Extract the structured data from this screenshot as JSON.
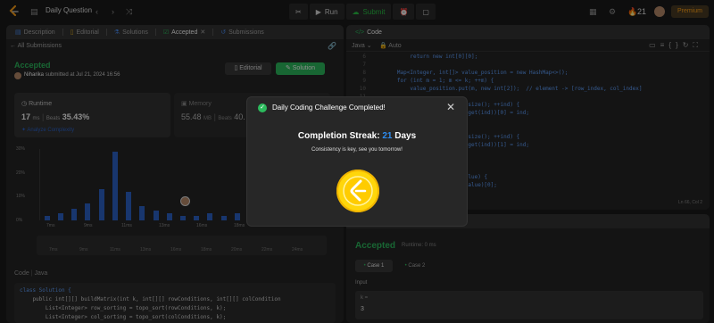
{
  "topbar": {
    "title": "Daily Question",
    "run": "Run",
    "submit": "Submit",
    "streak_count": "21",
    "premium": "Premium"
  },
  "left_panel": {
    "tabs": [
      {
        "label": "Description"
      },
      {
        "label": "Editorial"
      },
      {
        "label": "Solutions"
      },
      {
        "label": "Accepted"
      },
      {
        "label": "Submissions"
      }
    ],
    "back_link": "All Submissions",
    "status": "Accepted",
    "author": "Niharika",
    "submitted": "submitted at Jul 21, 2024 16:56",
    "editorial_btn": "Editorial",
    "solution_btn": "Solution",
    "runtime": {
      "label": "Runtime",
      "value": "17",
      "unit": "ms",
      "beats_label": "Beats",
      "beats_value": "35.43%"
    },
    "memory": {
      "label": "Memory",
      "value": "55.48",
      "unit": "MB",
      "beats_label": "Beats",
      "beats_value": "40."
    },
    "analyze": "Analyze Complexity",
    "code_header": "Code",
    "language": "Java"
  },
  "chart_data": {
    "type": "bar",
    "ylabel_ticks": [
      "30%",
      "20%",
      "10%",
      "0%"
    ],
    "ylim": [
      0,
      30
    ],
    "x_ticks": [
      "7ms",
      "9ms",
      "11ms",
      "13ms",
      "16ms",
      "18ms",
      "20ms"
    ],
    "x_ticks_range": [
      "7ms",
      "9ms",
      "11ms",
      "13ms",
      "16ms",
      "18ms",
      "20ms",
      "22ms",
      "24ms"
    ],
    "values": [
      2,
      3,
      5,
      7,
      13,
      29,
      12,
      6,
      4,
      3,
      2,
      2,
      3,
      2,
      3,
      2,
      2,
      4,
      1,
      3,
      2
    ]
  },
  "code_editor": {
    "title": "Code",
    "language": "Java",
    "mode": "Auto",
    "lines": [
      {
        "n": "6",
        "text": "            return new int[0][0];"
      },
      {
        "n": "7",
        "text": ""
      },
      {
        "n": "8",
        "text": "        Map<Integer, int[]> value_position = new HashMap<>();"
      },
      {
        "n": "9",
        "text": "        for (int m = 1; m <= k; ++m) {"
      },
      {
        "n": "10",
        "text": "            value_position.put(m, new int[2]);  // element -> [row_index, col_index]"
      },
      {
        "n": "11",
        "text": ""
      },
      {
        "n": "12",
        "text": "                < row_sorting.size(); ++ind) {"
      },
      {
        "n": "13",
        "text": "                t(row_sorting.get(ind))[0] = ind;"
      },
      {
        "n": "14",
        "text": ""
      },
      {
        "n": "15",
        "text": ""
      },
      {
        "n": "16",
        "text": "                < col_sorting.size(); ++ind) {"
      },
      {
        "n": "17",
        "text": "                t(col_sorting.get(ind))[1] = ind;"
      },
      {
        "n": "18",
        "text": ""
      },
      {
        "n": "19",
        "text": ""
      },
      {
        "n": "20",
        "text": "                [k][k];"
      },
      {
        "n": "21",
        "text": "                lue <= k; ++value) {"
      },
      {
        "n": "22",
        "text": "                position.get(value)[0];"
      }
    ],
    "cursor": "Ln 66, Col 2"
  },
  "solution_code": [
    "class Solution {",
    "    public int[][] buildMatrix(int k, int[][] rowConditions, int[][] colCondition",
    "        List<Integer> row_sorting = topo_sort(rowConditions, k);",
    "        List<Integer> col_sorting = topo_sort(colConditions, k);"
  ],
  "test_panel": {
    "status": "Accepted",
    "runtime": "Runtime: 0 ms",
    "cases": [
      "Case 1",
      "Case 2"
    ],
    "input_label": "Input",
    "k_label": "k =",
    "k_value": "3"
  },
  "modal": {
    "title": "Daily Coding Challenge Completed!",
    "streak_label": "Completion Streak:",
    "streak_value": "21",
    "streak_unit": "Days",
    "subtitle": "Consistency is key, see you tomorrow!"
  }
}
